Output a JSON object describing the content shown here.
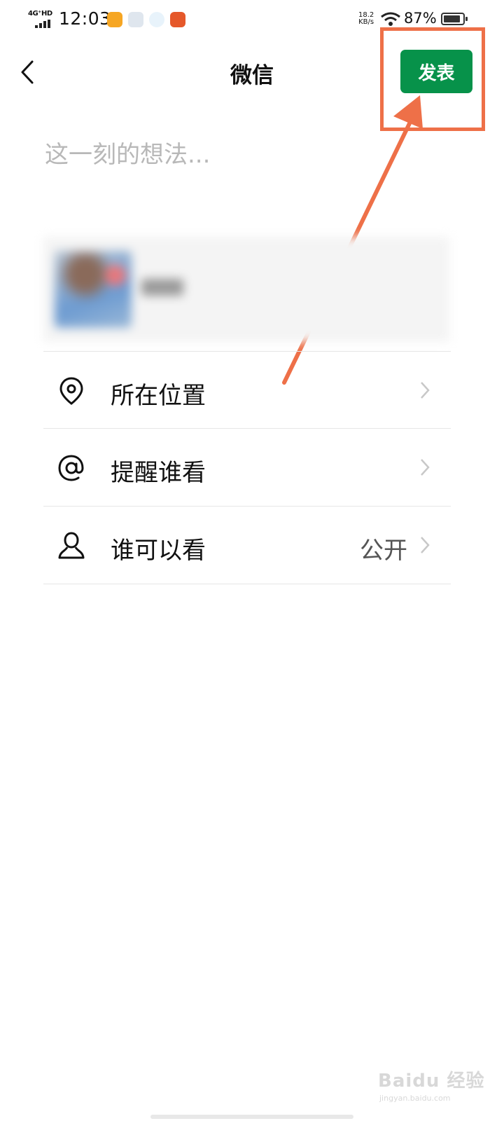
{
  "status_bar": {
    "network": "4G⁺HD",
    "time": "12:03",
    "speed_value": "18.2",
    "speed_unit": "KB/s",
    "battery_percent": "87%",
    "battery_level": 0.87,
    "notification_icons": [
      "weibo-icon",
      "app-icon",
      "k-icon",
      "news-icon"
    ]
  },
  "header": {
    "title": "微信",
    "publish_label": "发表"
  },
  "composer": {
    "placeholder": "这一刻的想法...",
    "value": ""
  },
  "options": [
    {
      "icon": "location-pin-icon",
      "label": "所在位置",
      "value": ""
    },
    {
      "icon": "at-sign-icon",
      "label": "提醒谁看",
      "value": ""
    },
    {
      "icon": "person-icon",
      "label": "谁可以看",
      "value": "公开"
    }
  ],
  "watermark": {
    "main": "Baidu 经验",
    "sub": "jingyan.baidu.com"
  },
  "colors": {
    "publish_button": "#07924a",
    "annotation": "#ee7048"
  }
}
